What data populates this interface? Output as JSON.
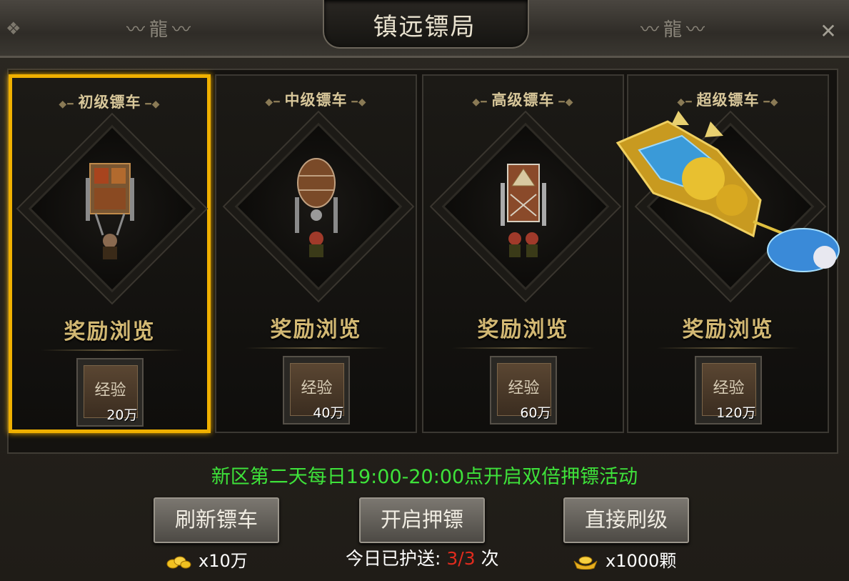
{
  "window": {
    "title": "镇远镖局",
    "close_icon": "close-icon"
  },
  "cards": [
    {
      "name": "初级镖车",
      "reward_label": "奖励浏览",
      "reward_type": "经验",
      "reward_amount": "20万",
      "selected": true
    },
    {
      "name": "中级镖车",
      "reward_label": "奖励浏览",
      "reward_type": "经验",
      "reward_amount": "40万",
      "selected": false
    },
    {
      "name": "高级镖车",
      "reward_label": "奖励浏览",
      "reward_type": "经验",
      "reward_amount": "60万",
      "selected": false
    },
    {
      "name": "超级镖车",
      "reward_label": "奖励浏览",
      "reward_type": "经验",
      "reward_amount": "120万",
      "selected": false
    }
  ],
  "notice": "新区第二天每日19:00-20:00点开启双倍押镖活动",
  "buttons": {
    "refresh": "刷新镖车",
    "start": "开启押镖",
    "upgrade": "直接刷级"
  },
  "costs": {
    "refresh": "x10万",
    "upgrade": "x1000颗"
  },
  "today": {
    "label": "今日已护送:",
    "count": "3/3",
    "unit": "次"
  },
  "colors": {
    "selected_border": "#f0b000",
    "notice_green": "#3ee23a",
    "count_red": "#e02b1e"
  }
}
